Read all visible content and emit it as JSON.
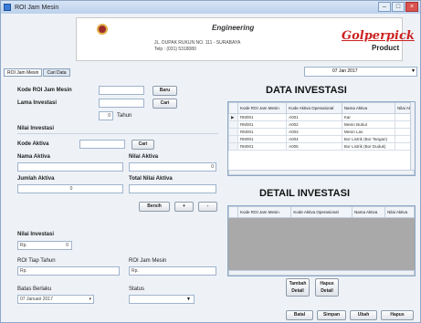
{
  "window": {
    "title": "ROI Jam Mesin"
  },
  "titlebar_buttons": [
    "–",
    "□",
    "×"
  ],
  "header": {
    "company": "",
    "engineering": "Engineering",
    "address_line1": "JL. DUPAK RUKUN NO. 111 - SURABAYA",
    "address_line2": "Telp : (031) 5318080",
    "brand": "Golperpick",
    "product": "Product"
  },
  "tabs": [
    "ROI Jam Mesin",
    "Cari Data"
  ],
  "top_date": "07 Jan 2017",
  "form": {
    "kode_roi_label": "Kode ROI Jam Mesin",
    "baru_button": "Baru",
    "lama_investasi_label": "Lama Investasi",
    "cari_button_1": "Cari",
    "tahun_value": "0",
    "tahun_label": "Tahun",
    "nilai_investasi_header": "Nilai Investasi",
    "kode_aktiva_label": "Kode Aktiva",
    "cari_button_2": "Cari",
    "nama_aktiva_label": "Nama Aktiva",
    "nilai_aktiva_label": "Nilai Aktiva",
    "nilai_aktiva_value": "0",
    "jumlah_aktiva_label": "Jumlah Aktiva",
    "jumlah_aktiva_value": "0",
    "total_nilai_aktiva_label": "Total Nilai Aktiva",
    "bersih_button": "Bersih",
    "plus_button": "+",
    "minus_button": "-",
    "nilai_investasi_label": "Nilai Investasi",
    "nilai_investasi_prefix": "Rp.",
    "nilai_investasi_value": "0",
    "roi_tiap_tahun_label": "ROI Tiap Tahun",
    "roi_tiap_tahun_prefix": "Rp.",
    "roi_jam_mesin_label": "ROI Jam Mesin",
    "roi_jam_mesin_prefix": "Rp.",
    "batas_berlaku_label": "Batas Berlaku",
    "batas_berlaku_value": "07 Januari 2017",
    "status_label": "Status"
  },
  "data_investasi": {
    "title": "DATA INVESTASI",
    "columns": [
      "Kode ROI Jam Mesin",
      "Kode Aktiva Operasional",
      "Nama Aktiva",
      "Nilai Ak"
    ],
    "rows": [
      [
        "RM001",
        "A001",
        "Kar",
        ""
      ],
      [
        "RM001",
        "A002",
        "Mesin Bubut",
        ""
      ],
      [
        "RM001",
        "A003",
        "Mesin Las",
        ""
      ],
      [
        "RM001",
        "A004",
        "Bor Listrik (Bor Tangan)",
        ""
      ],
      [
        "RM001",
        "A005",
        "Bor Listrik (Bor Duduk)",
        ""
      ]
    ]
  },
  "detail_investasi": {
    "title": "DETAIL INVESTASI",
    "columns": [
      "Kode ROI Jam Mesin",
      "Kode Aktiva Operasional",
      "Nama Aktiva",
      "Nilai Aktiva"
    ]
  },
  "detail_buttons": {
    "tambah": "Tambah Detail",
    "hapus": "Hapus Detail"
  },
  "bottom_buttons": [
    "Batal",
    "Simpan",
    "Ubah",
    "Hapus"
  ]
}
